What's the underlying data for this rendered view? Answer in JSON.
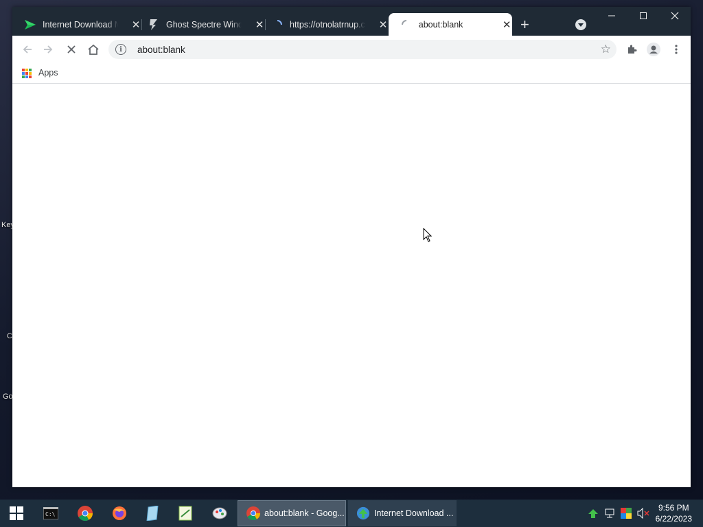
{
  "desktop": {
    "labels": [
      "Key",
      "C",
      "Go"
    ]
  },
  "browser": {
    "tabs": [
      {
        "title": "Internet Download Manager",
        "icon": "idm-play-icon",
        "active": false
      },
      {
        "title": "Ghost Spectre Windows",
        "icon": "ghost-spectre-icon",
        "active": false
      },
      {
        "title": "https://otnolatrnup.com",
        "icon": "loading-spinner-icon",
        "active": false
      },
      {
        "title": "about:blank",
        "icon": "loading-spinner-icon",
        "active": true
      }
    ],
    "newtab_label": "+",
    "close_glyph": "✕",
    "address": "about:blank",
    "bookmarks": {
      "apps_label": "Apps"
    }
  },
  "taskbar": {
    "apps": [
      {
        "label": "about:blank - Goog...",
        "icon": "chrome-icon",
        "active": true
      },
      {
        "label": "Internet Download ...",
        "icon": "idm-icon",
        "active": false
      }
    ],
    "clock": {
      "time": "9:56 PM",
      "date": "6/22/2023"
    }
  },
  "colors": {
    "tabstrip": "#1f2a35",
    "taskbar": "#1d2e3d",
    "omnibox": "#f1f3f4"
  }
}
